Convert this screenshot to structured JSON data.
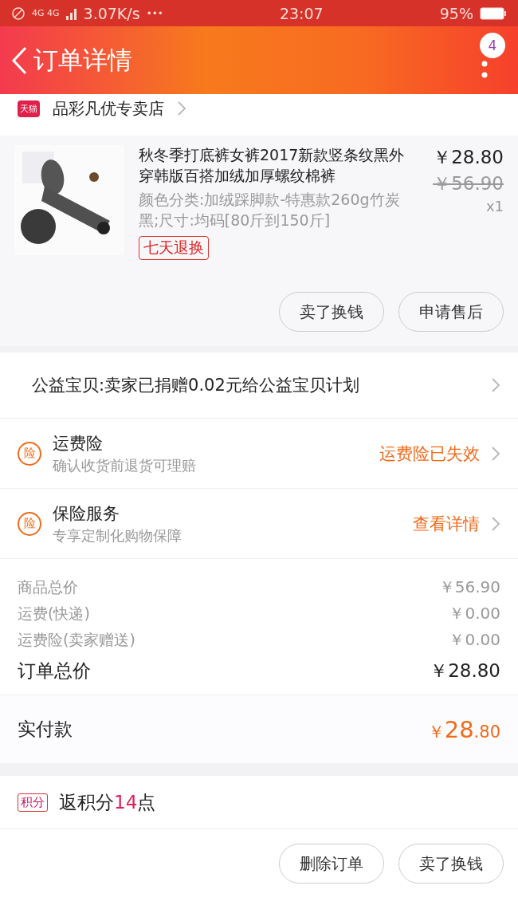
{
  "status_bar": {
    "network": "4G 4G",
    "speed": "3.07K/s",
    "more": "•••",
    "time": "23:07",
    "battery": "95%"
  },
  "header": {
    "title": "订单详情",
    "badge": "4"
  },
  "store": {
    "tag": "天猫",
    "name": "品彩凡优专卖店"
  },
  "product": {
    "title": "秋冬季打底裤女裤2017新款竖条纹黑外穿韩版百搭加绒加厚螺纹棉裤",
    "spec": "颜色分类:加绒踩脚款-特惠款260g竹炭黑;尺寸:均码[80斤到150斤]",
    "tag": "七天退换",
    "price": "￥28.80",
    "original_price": "￥56.90",
    "quantity": "x1",
    "buttons": [
      "卖了换钱",
      "申请售后"
    ]
  },
  "charity": {
    "text": "公益宝贝:卖家已捐赠0.02元给公益宝贝计划"
  },
  "services": [
    {
      "icon": "险",
      "title": "运费险",
      "subtitle": "确认收货前退货可理赔",
      "action": "运费险已失效"
    },
    {
      "icon": "险",
      "title": "保险服务",
      "subtitle": "专享定制化购物保障",
      "action": "查看详情"
    }
  ],
  "summary": [
    {
      "label": "商品总价",
      "value": "￥56.90",
      "kind": "minor"
    },
    {
      "label": "运费(快递)",
      "value": "￥0.00",
      "kind": "minor"
    },
    {
      "label": "运费险(卖家赠送)",
      "value": "￥0.00",
      "kind": "minor"
    },
    {
      "label": "订单总价",
      "value": "￥28.80",
      "kind": "major"
    }
  ],
  "paid": {
    "label": "实付款",
    "currency": "￥",
    "integer": "28",
    "decimal": ".80"
  },
  "points": {
    "tag": "积分",
    "prefix": "返积分",
    "amount": "14",
    "suffix": "点"
  },
  "footer_buttons": [
    "删除订单",
    "卖了换钱"
  ]
}
